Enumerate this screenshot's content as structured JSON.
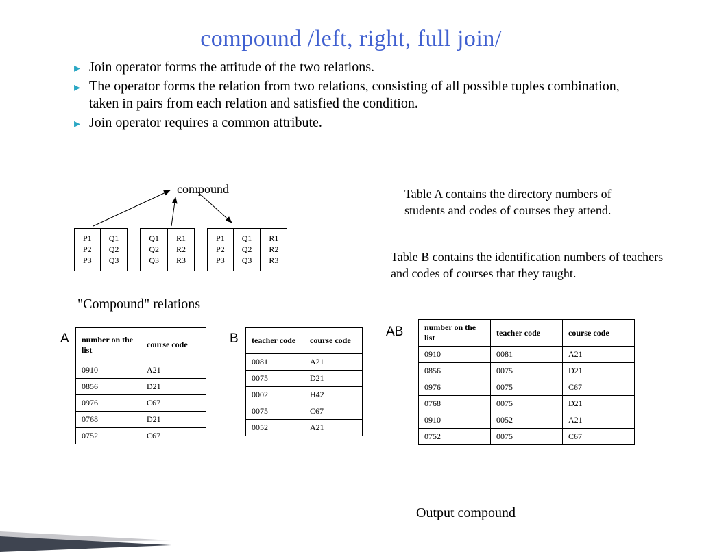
{
  "title": "compound /left, right, full join/",
  "bullets": [
    "Join operator forms the attitude of the two relations.",
    "The operator forms the relation from two relations, consisting of all possible tuples combination, taken in pairs from each relation and satisfied the condition.",
    "Join operator requires a common attribute."
  ],
  "compound_label": "compound",
  "mini_tables": [
    [
      [
        "P1",
        "P2",
        "P3"
      ],
      [
        "Q1",
        "Q2",
        "Q3"
      ]
    ],
    [
      [
        "Q1",
        "Q2",
        "Q3"
      ],
      [
        "R1",
        "R2",
        "R3"
      ]
    ],
    [
      [
        "P1",
        "P2",
        "P3"
      ],
      [
        "Q1",
        "Q2",
        "Q3"
      ],
      [
        "R1",
        "R2",
        "R3"
      ]
    ]
  ],
  "desc_a": "Table A contains the directory numbers of students and codes of courses they attend.",
  "desc_b": "Table B contains the identification numbers of teachers and codes of courses that they taught.",
  "compound_relations": "\"Compound\" relations",
  "labels": {
    "A": "А",
    "B": "В",
    "AB": "АВ"
  },
  "tableA": {
    "headers": [
      "number on the list",
      "course code"
    ],
    "rows": [
      [
        "0910",
        "A21"
      ],
      [
        "0856",
        "D21"
      ],
      [
        "0976",
        "C67"
      ],
      [
        "0768",
        "D21"
      ],
      [
        "0752",
        "C67"
      ]
    ]
  },
  "tableB": {
    "headers": [
      "teacher code",
      "course code"
    ],
    "rows": [
      [
        "0081",
        "A21"
      ],
      [
        "0075",
        "D21"
      ],
      [
        "0002",
        "H42"
      ],
      [
        "0075",
        "C67"
      ],
      [
        "0052",
        "A21"
      ]
    ]
  },
  "tableAB": {
    "headers": [
      "number on the list",
      "teacher code",
      "course code"
    ],
    "rows": [
      [
        "0910",
        "0081",
        "A21"
      ],
      [
        "0856",
        "0075",
        "D21"
      ],
      [
        "0976",
        "0075",
        "C67"
      ],
      [
        "0768",
        "0075",
        "D21"
      ],
      [
        "0910",
        "0052",
        "A21"
      ],
      [
        "0752",
        "0075",
        "C67"
      ]
    ]
  },
  "output_label": "Output compound"
}
